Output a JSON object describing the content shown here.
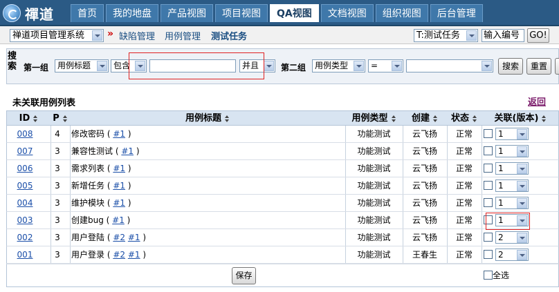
{
  "nav": {
    "logo_text": "禪道",
    "tabs": [
      "首页",
      "我的地盘",
      "产品视图",
      "项目视图",
      "QA视图",
      "文档视图",
      "组织视图",
      "后台管理"
    ],
    "active_tab": "QA视图"
  },
  "subnav": {
    "product_select": "禅道项目管理系统",
    "separator": "»",
    "links": [
      "缺陷管理",
      "用例管理",
      "测试任务"
    ],
    "active_link": "测试任务",
    "task_select": "T:测试任务",
    "code_input": "输入编号",
    "go_button": "GO!"
  },
  "search": {
    "label": "搜索",
    "group1": {
      "label": "第一组",
      "field": "用例标题",
      "operator": "包含",
      "value": "",
      "logic": "并且"
    },
    "group2": {
      "label": "第二组",
      "field": "用例类型",
      "operator": "=",
      "value": ""
    },
    "search_button": "搜索",
    "reset_button": "重置"
  },
  "list": {
    "title": "未关联用例列表",
    "back_link": "返回"
  },
  "table": {
    "columns": [
      "ID",
      "P",
      "用例标题",
      "用例类型",
      "创建",
      "状态",
      "关联(版本)"
    ],
    "rows": [
      {
        "id": "008",
        "p": "4",
        "title": "修改密码",
        "links": [
          "#1"
        ],
        "type": "功能测试",
        "creator": "云飞扬",
        "status": "正常",
        "version": "1"
      },
      {
        "id": "007",
        "p": "3",
        "title": "兼容性测试",
        "links": [
          "#1"
        ],
        "type": "功能测试",
        "creator": "云飞扬",
        "status": "正常",
        "version": "1"
      },
      {
        "id": "006",
        "p": "3",
        "title": "需求列表",
        "links": [
          "#1"
        ],
        "type": "功能测试",
        "creator": "云飞扬",
        "status": "正常",
        "version": "1"
      },
      {
        "id": "005",
        "p": "3",
        "title": "新增任务",
        "links": [
          "#1"
        ],
        "type": "功能测试",
        "creator": "云飞扬",
        "status": "正常",
        "version": "1"
      },
      {
        "id": "004",
        "p": "3",
        "title": "维护模块",
        "links": [
          "#1"
        ],
        "type": "功能测试",
        "creator": "云飞扬",
        "status": "正常",
        "version": "1"
      },
      {
        "id": "003",
        "p": "3",
        "title": "创建bug",
        "links": [
          "#1"
        ],
        "type": "功能测试",
        "creator": "云飞扬",
        "status": "正常",
        "version": "1"
      },
      {
        "id": "002",
        "p": "3",
        "title": "用户登陆",
        "links": [
          "#2",
          "#1"
        ],
        "type": "功能测试",
        "creator": "云飞扬",
        "status": "正常",
        "version": "2"
      },
      {
        "id": "001",
        "p": "3",
        "title": "用户登录",
        "links": [
          "#2",
          "#1"
        ],
        "type": "功能测试",
        "creator": "王春生",
        "status": "正常",
        "version": "2"
      }
    ],
    "save_button": "保存",
    "select_all_label": "全选"
  },
  "colors": {
    "nav_bg": "#2b5a85",
    "header_bg": "#d8e4f1",
    "link": "#1a4ea8",
    "highlight": "#e02020"
  }
}
